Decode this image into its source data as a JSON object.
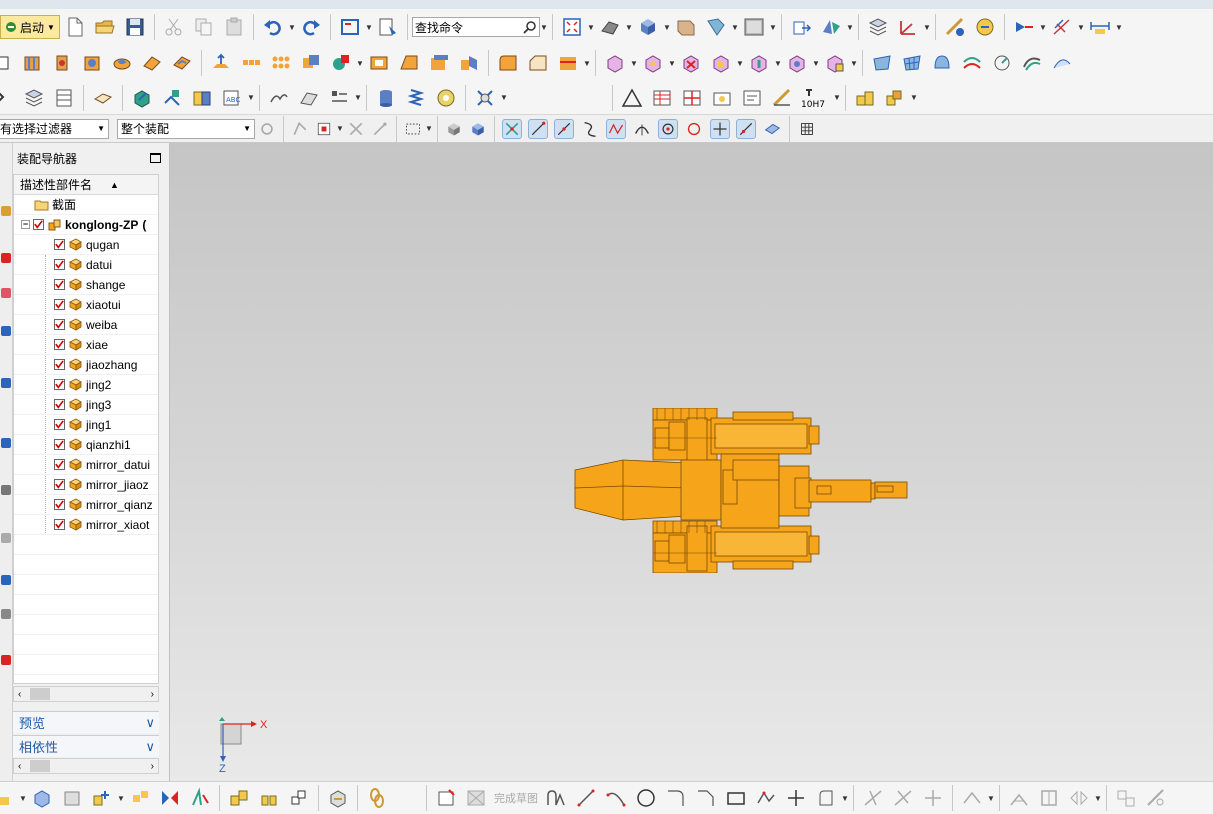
{
  "toolbar": {
    "start_label": "启动",
    "search_placeholder": "查找命令",
    "filter_label": "有选择过滤器",
    "assembly_scope": "整个装配",
    "fit_label": "10H7"
  },
  "navigator": {
    "title": "装配导航器",
    "column_header": "描述性部件名",
    "section_item": "截面",
    "root": "konglong-ZP",
    "parts": [
      "qugan",
      "datui",
      "shange",
      "xiaotui",
      "weiba",
      "xiae",
      "jiaozhang",
      "jing2",
      "jing3",
      "jing1",
      "qianzhi1",
      "mirror_datui",
      "mirror_jiaoz",
      "mirror_qianz",
      "mirror_xiaot"
    ]
  },
  "panels": {
    "preview": "预览",
    "dependencies": "相依性"
  },
  "viewport": {
    "axis_x": "X",
    "axis_z": "Z",
    "model_color": "#FFA500"
  },
  "bottom": {
    "finish_sketch": "完成草图"
  },
  "colors": {
    "accent_blue": "#1e5aa8",
    "checkbox_red": "#d00000",
    "part_orange": "#f4a51c"
  }
}
